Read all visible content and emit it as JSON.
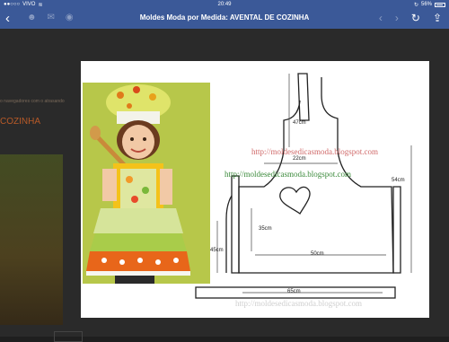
{
  "status_bar": {
    "carrier": "VIVO",
    "time": "20:49",
    "battery": "56%"
  },
  "nav": {
    "back_glyph": "‹",
    "title": "Moldes Moda por Medida: AVENTAL DE COZINHA",
    "icons": [
      "people-icon",
      "chat-icon",
      "globe-icon",
      "back-arrow-icon",
      "forward-arrow-icon",
      "refresh-icon",
      "share-icon"
    ]
  },
  "background": {
    "text1": "o navegadores com o atrasando",
    "text2": "COZINHA"
  },
  "pattern": {
    "watermark_1": "http://moldesedicasmoda.blogspot.com",
    "watermark_2": "http://moldesedicasmoda.blogspot.com",
    "watermark_3": "http://moldesedicasmoda.blogspot.com",
    "dims": {
      "strap": "47cm",
      "top_width": "22cm",
      "body_height": "54cm",
      "pocket": "35cm",
      "waist": "50cm",
      "side": "45cm",
      "tie": "65cm"
    }
  },
  "colors": {
    "accent": "#3b5998",
    "watermark_red": "#d06a6a",
    "watermark_green": "#3b8a3b"
  }
}
